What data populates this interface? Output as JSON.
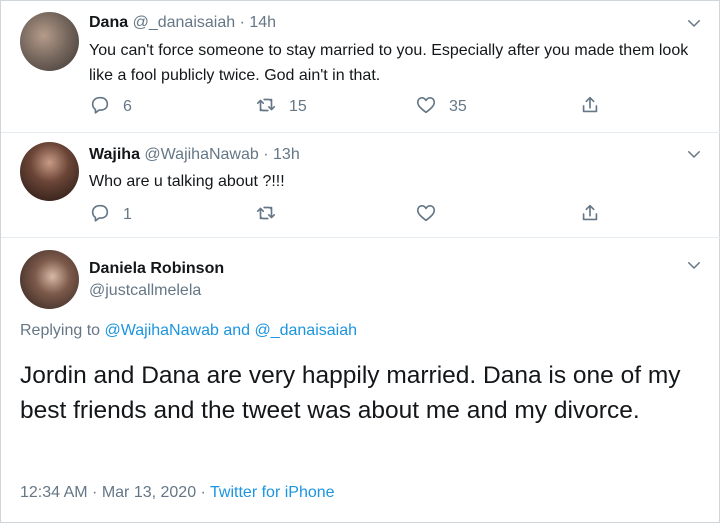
{
  "tweets": [
    {
      "name": "Dana",
      "handle": "@_danaisaiah",
      "separator": "·",
      "time": "14h",
      "text": "You can't force someone to stay married to you. Especially after you made them look like a fool publicly twice. God ain't in that.",
      "reply_count": "6",
      "retweet_count": "15",
      "like_count": "35"
    },
    {
      "name": "Wajiha",
      "handle": "@WajihaNawab",
      "separator": "·",
      "time": "13h",
      "text": "Who are u talking about ?!!!",
      "reply_count": "1",
      "retweet_count": "",
      "like_count": ""
    }
  ],
  "main_tweet": {
    "name": "Daniela Robinson",
    "handle": "@justcallmelela",
    "replying_prefix": "Replying to",
    "reply_to_1": "@WajihaNawab",
    "reply_and": "and",
    "reply_to_2": "@_danaisaiah",
    "text": "Jordin and Dana are very happily married. Dana is one of my best friends and the tweet was about me and my divorce.",
    "timestamp": "12:34 AM · Mar 13, 2020 ·",
    "source": "Twitter for iPhone"
  },
  "colors": {
    "link": "#1b95e0",
    "muted": "#657786",
    "text": "#14171a"
  },
  "icons": [
    "reply-icon",
    "retweet-icon",
    "like-icon",
    "share-icon",
    "chevron-down-icon"
  ]
}
